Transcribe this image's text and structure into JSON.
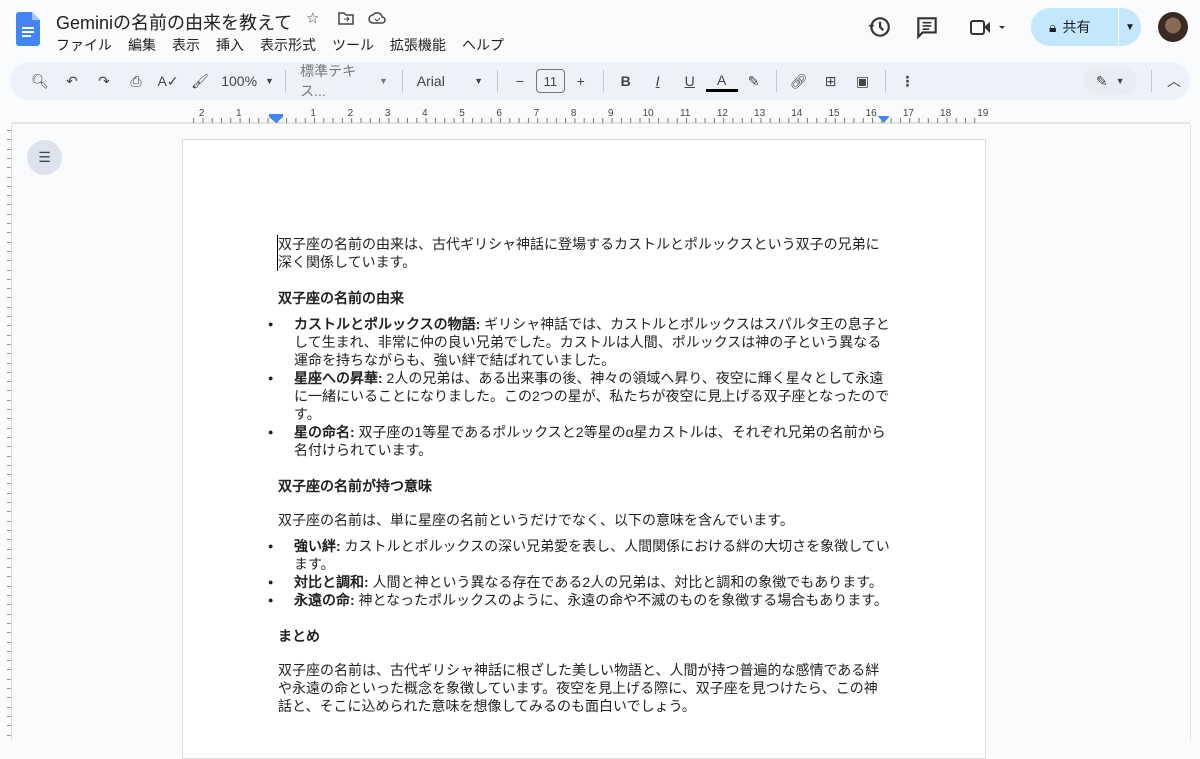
{
  "header": {
    "title": "Geminiの名前の由来を教えて",
    "menu": [
      "ファイル",
      "編集",
      "表示",
      "挿入",
      "表示形式",
      "ツール",
      "拡張機能",
      "ヘルプ"
    ],
    "share_label": "共有"
  },
  "toolbar": {
    "zoom": "100%",
    "style": "標準テキス...",
    "font": "Arial",
    "font_size": "11"
  },
  "ruler": {
    "labels": [
      "2",
      "1",
      "1",
      "2",
      "3",
      "4",
      "5",
      "6",
      "7",
      "8",
      "9",
      "10",
      "11",
      "12",
      "13",
      "14",
      "15",
      "16",
      "17",
      "18",
      "19"
    ]
  },
  "doc": {
    "intro": "双子座の名前の由来は、古代ギリシャ神話に登場するカストルとポルックスという双子の兄弟に深く関係しています。",
    "h1": "双子座の名前の由来",
    "list1": [
      {
        "b": "カストルとポルックスの物語:",
        "t": " ギリシャ神話では、カストルとポルックスはスパルタ王の息子として生まれ、非常に仲の良い兄弟でした。カストルは人間、ポルックスは神の子という異なる運命を持ちながらも、強い絆で結ばれていました。"
      },
      {
        "b": "星座への昇華:",
        "t": " 2人の兄弟は、ある出来事の後、神々の領域へ昇り、夜空に輝く星々として永遠に一緒にいることになりました。この2つの星が、私たちが夜空に見上げる双子座となったのです。"
      },
      {
        "b": "星の命名:",
        "t": " 双子座の1等星であるポルックスと2等星のα星カストルは、それぞれ兄弟の名前から名付けられています。"
      }
    ],
    "h2": "双子座の名前が持つ意味",
    "p2": "双子座の名前は、単に星座の名前というだけでなく、以下の意味を含んでいます。",
    "list2": [
      {
        "b": "強い絆:",
        "t": " カストルとポルックスの深い兄弟愛を表し、人間関係における絆の大切さを象徴しています。"
      },
      {
        "b": "対比と調和:",
        "t": " 人間と神という異なる存在である2人の兄弟は、対比と調和の象徴でもあります。"
      },
      {
        "b": "永遠の命:",
        "t": " 神となったポルックスのように、永遠の命や不滅のものを象徴する場合もあります。"
      }
    ],
    "h3": "まとめ",
    "p3": "双子座の名前は、古代ギリシャ神話に根ざした美しい物語と、人間が持つ普遍的な感情である絆や永遠の命といった概念を象徴しています。夜空を見上げる際に、双子座を見つけたら、この神話と、そこに込められた意味を想像してみるのも面白いでしょう。"
  }
}
